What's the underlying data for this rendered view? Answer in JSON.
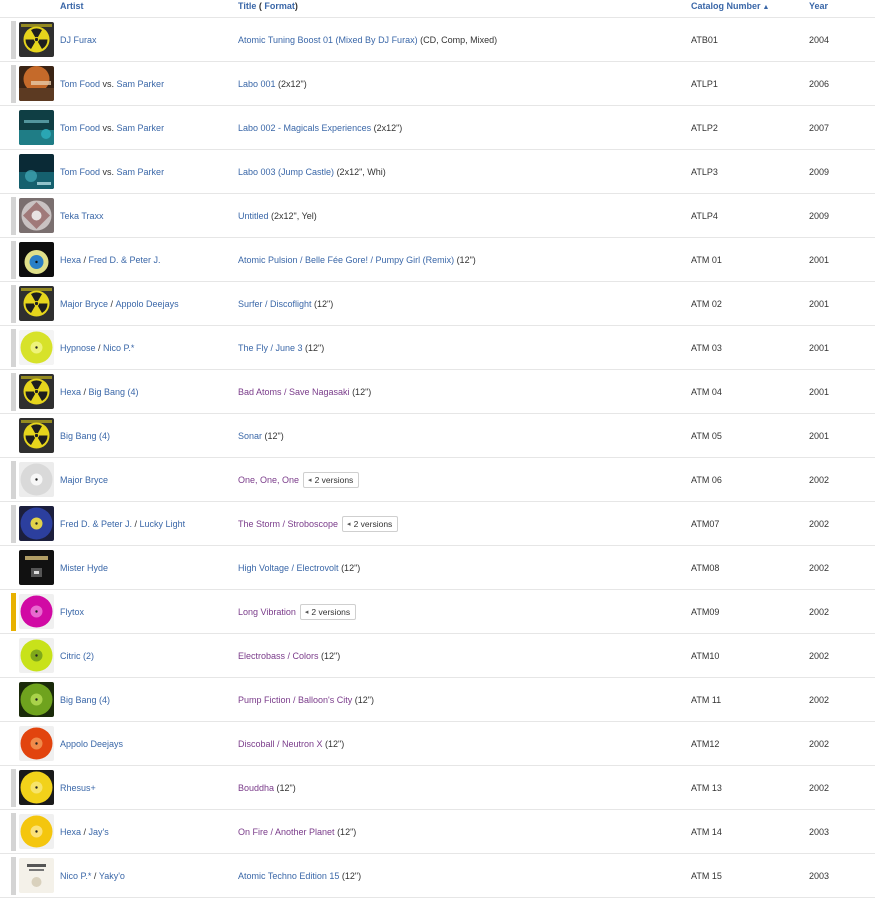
{
  "header": {
    "artist": "Artist",
    "title": "Title",
    "title_paren_open": "(",
    "format": "Format",
    "title_paren_close": ")",
    "catalog": "Catalog Number",
    "catalog_sort_icon": "chevron-up-icon",
    "year": "Year"
  },
  "colors": {
    "link": "#3a67a8",
    "visited": "#7a3b8a",
    "bar_default": "#d4d4d4",
    "bar_highlight": "#e8b100"
  },
  "rows": [
    {
      "artists": [
        {
          "name": "DJ Furax"
        }
      ],
      "titles": [
        {
          "text": "Atomic Tuning Boost 01 (Mixed By DJ Furax)",
          "visited": false
        }
      ],
      "format": " (CD, Comp, Mixed)",
      "versions": "",
      "catno": "ATB01",
      "year": "2004",
      "thumb": "radioactive",
      "bar": "#d4d4d4"
    },
    {
      "artists": [
        {
          "name": "Tom Food",
          "sep": " vs. "
        },
        {
          "name": "Sam Parker"
        }
      ],
      "titles": [
        {
          "text": "Labo 001",
          "visited": false
        }
      ],
      "format": " (2x12\")",
      "versions": "",
      "catno": "ATLP1",
      "year": "2006",
      "thumb": "orange-dark",
      "bar": "#d4d4d4"
    },
    {
      "artists": [
        {
          "name": "Tom Food",
          "sep": " vs. "
        },
        {
          "name": "Sam Parker"
        }
      ],
      "titles": [
        {
          "text": "Labo 002 - Magicals Experiences",
          "visited": false
        }
      ],
      "format": " (2x12\")",
      "versions": "",
      "catno": "ATLP2",
      "year": "2007",
      "thumb": "teal",
      "bar": "none"
    },
    {
      "artists": [
        {
          "name": "Tom Food",
          "sep": " vs. "
        },
        {
          "name": "Sam Parker"
        }
      ],
      "titles": [
        {
          "text": "Labo 003 (Jump Castle)",
          "visited": false
        }
      ],
      "format": " (2x12\", Whi)",
      "versions": "",
      "catno": "ATLP3",
      "year": "2009",
      "thumb": "teal-dark",
      "bar": "none"
    },
    {
      "artists": [
        {
          "name": "Teka Traxx"
        }
      ],
      "titles": [
        {
          "text": "Untitled",
          "visited": false
        }
      ],
      "format": " (2x12\", Yel)",
      "versions": "",
      "catno": "ATLP4",
      "year": "2009",
      "thumb": "grey-pattern",
      "bar": "#d4d4d4"
    },
    {
      "artists": [
        {
          "name": "Hexa",
          "sep": " / "
        },
        {
          "name": "Fred D. & Peter J."
        }
      ],
      "titles": [
        {
          "text": "Atomic Pulsion / Belle Fée Gore! / Pumpy Girl (Remix)",
          "visited": false
        }
      ],
      "format": " (12\")",
      "versions": "",
      "catno": "ATM 01",
      "year": "2001",
      "thumb": "black-blue",
      "bar": "#d4d4d4"
    },
    {
      "artists": [
        {
          "name": "Major Bryce",
          "sep": " / "
        },
        {
          "name": "Appolo Deejays"
        }
      ],
      "titles": [
        {
          "text": "Surfer / Discoflight",
          "visited": false
        }
      ],
      "format": " (12\")",
      "versions": "",
      "catno": "ATM 02",
      "year": "2001",
      "thumb": "radioactive",
      "bar": "#d4d4d4"
    },
    {
      "artists": [
        {
          "name": "Hypnose",
          "sep": " / "
        },
        {
          "name": "Nico P.*"
        }
      ],
      "titles": [
        {
          "text": "The Fly / June 3",
          "visited": false
        }
      ],
      "format": " (12\")",
      "versions": "",
      "catno": "ATM 03",
      "year": "2001",
      "thumb": "yellow-disc",
      "bar": "#d4d4d4"
    },
    {
      "artists": [
        {
          "name": "Hexa",
          "sep": " / "
        },
        {
          "name": "Big Bang (4)"
        }
      ],
      "titles": [
        {
          "text": "Bad Atoms / Save Nagasaki",
          "visited": true
        }
      ],
      "format": " (12\")",
      "versions": "",
      "catno": "ATM 04",
      "year": "2001",
      "thumb": "radioactive",
      "bar": "#d4d4d4"
    },
    {
      "artists": [
        {
          "name": "Big Bang (4)"
        }
      ],
      "titles": [
        {
          "text": "Sonar",
          "visited": false
        }
      ],
      "format": " (12\")",
      "versions": "",
      "catno": "ATM 05",
      "year": "2001",
      "thumb": "radioactive",
      "bar": "none"
    },
    {
      "artists": [
        {
          "name": "Major Bryce"
        }
      ],
      "titles": [
        {
          "text": "One, One, One",
          "visited": true
        }
      ],
      "format": "",
      "versions": "2 versions",
      "catno": "ATM 06",
      "year": "2002",
      "thumb": "white-disc",
      "bar": "#d4d4d4"
    },
    {
      "artists": [
        {
          "name": "Fred D. & Peter J.",
          "sep": " / "
        },
        {
          "name": "Lucky Light"
        }
      ],
      "titles": [
        {
          "text": "The Storm / Stroboscope",
          "visited": true
        }
      ],
      "format": "",
      "versions": "2 versions",
      "catno": "ATM07",
      "year": "2002",
      "thumb": "blue-disc",
      "bar": "#d4d4d4"
    },
    {
      "artists": [
        {
          "name": "Mister Hyde"
        }
      ],
      "titles": [
        {
          "text": "High Voltage / Electrovolt",
          "visited": false
        }
      ],
      "format": " (12\")",
      "versions": "",
      "catno": "ATM08",
      "year": "2002",
      "thumb": "black-sleeve",
      "bar": "none"
    },
    {
      "artists": [
        {
          "name": "Flytox"
        }
      ],
      "titles": [
        {
          "text": "Long Vibration",
          "visited": true
        }
      ],
      "format": "",
      "versions": "2 versions",
      "catno": "ATM09",
      "year": "2002",
      "thumb": "magenta-disc",
      "bar": "#e8b100"
    },
    {
      "artists": [
        {
          "name": "Citric (2)"
        }
      ],
      "titles": [
        {
          "text": "Electrobass / Colors",
          "visited": true
        }
      ],
      "format": " (12\")",
      "versions": "",
      "catno": "ATM10",
      "year": "2002",
      "thumb": "lime-disc",
      "bar": "none"
    },
    {
      "artists": [
        {
          "name": "Big Bang (4)"
        }
      ],
      "titles": [
        {
          "text": "Pump Fiction / Balloon's City",
          "visited": true
        }
      ],
      "format": " (12\")",
      "versions": "",
      "catno": "ATM 11",
      "year": "2002",
      "thumb": "green-disc",
      "bar": "none"
    },
    {
      "artists": [
        {
          "name": "Appolo Deejays"
        }
      ],
      "titles": [
        {
          "text": "Discoball / Neutron X",
          "visited": true
        }
      ],
      "format": " (12\")",
      "versions": "",
      "catno": "ATM12",
      "year": "2002",
      "thumb": "orange-disc",
      "bar": "none"
    },
    {
      "artists": [
        {
          "name": "Rhesus+"
        }
      ],
      "titles": [
        {
          "text": "Bouddha",
          "visited": true
        }
      ],
      "format": " (12\")",
      "versions": "",
      "catno": "ATM 13",
      "year": "2002",
      "thumb": "yellow-label",
      "bar": "#d4d4d4"
    },
    {
      "artists": [
        {
          "name": "Hexa",
          "sep": " / "
        },
        {
          "name": "Jay's"
        }
      ],
      "titles": [
        {
          "text": "On Fire / Another Planet",
          "visited": true
        }
      ],
      "format": " (12\")",
      "versions": "",
      "catno": "ATM 14",
      "year": "2003",
      "thumb": "yellow-label2",
      "bar": "#d4d4d4"
    },
    {
      "artists": [
        {
          "name": "Nico P.*",
          "sep": " / "
        },
        {
          "name": "Yaky'o"
        }
      ],
      "titles": [
        {
          "text": "Atomic Techno Edition 15",
          "visited": false
        }
      ],
      "format": " (12\")",
      "versions": "",
      "catno": "ATM 15",
      "year": "2003",
      "thumb": "white-label",
      "bar": "#d4d4d4"
    }
  ]
}
